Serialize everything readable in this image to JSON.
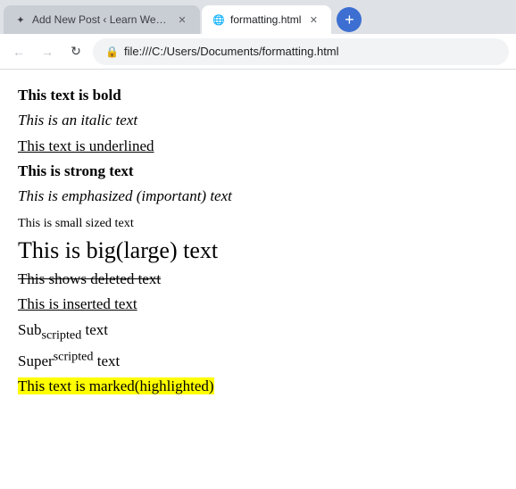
{
  "browser": {
    "tabs": [
      {
        "id": "tab1",
        "label": "Add New Post ‹ Learn Web With",
        "favicon": "✦",
        "active": true,
        "closable": true
      },
      {
        "id": "tab2",
        "label": "formatting.html",
        "favicon": "🌐",
        "active": false,
        "closable": true
      }
    ],
    "new_tab_label": "+",
    "nav": {
      "back_label": "←",
      "forward_label": "→",
      "reload_label": "↻"
    },
    "url": "file:///C:/Users/Documents/formatting.html",
    "url_icon": "🔒"
  },
  "content": {
    "lines": [
      {
        "id": "bold",
        "text": "This text is bold",
        "style": "bold"
      },
      {
        "id": "italic",
        "text": "This is an italic text",
        "style": "italic"
      },
      {
        "id": "underline",
        "text": "This text is underlined",
        "style": "underline"
      },
      {
        "id": "strong",
        "text": "This is strong text",
        "style": "strong"
      },
      {
        "id": "em",
        "text": "This is emphasized (important) text",
        "style": "em"
      },
      {
        "id": "small",
        "text": "This is small sized text",
        "style": "small"
      },
      {
        "id": "big",
        "text": "This is big(large) text",
        "style": "big"
      },
      {
        "id": "del",
        "text": "This shows deleted text",
        "style": "del"
      },
      {
        "id": "ins",
        "text": "This is inserted text",
        "style": "ins"
      },
      {
        "id": "sub",
        "text": "Sub-scripted text",
        "style": "sub",
        "sub": "scripted"
      },
      {
        "id": "sup",
        "text": "Super-scripted text",
        "style": "sup",
        "sup": "scripted"
      },
      {
        "id": "mark",
        "text": "This text is marked(highlighted)",
        "style": "mark"
      }
    ]
  }
}
